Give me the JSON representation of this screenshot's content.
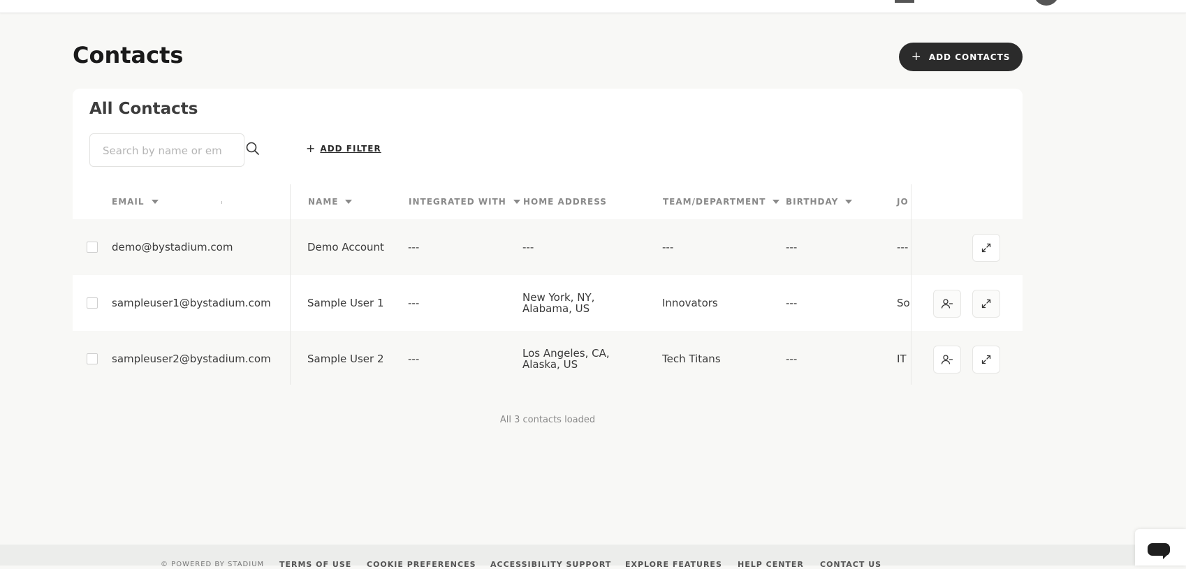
{
  "page": {
    "title": "Contacts",
    "add_contacts_label": "ADD CONTACTS"
  },
  "card": {
    "title": "All Contacts",
    "search": {
      "placeholder": "Search by name or email",
      "value": ""
    },
    "add_filter_label": "ADD FILTER"
  },
  "table": {
    "headers": {
      "email": "EMAIL",
      "name": "NAME",
      "integrated_with": "INTEGRATED WITH",
      "home_address": "HOME ADDRESS",
      "team": "TEAM/DEPARTMENT",
      "birthday": "BIRTHDAY",
      "job": "JO"
    },
    "rows": [
      {
        "email": "demo@bystadium.com",
        "name": "Demo Account",
        "integrated": "---",
        "address": "---",
        "team": "---",
        "birthday": "---",
        "job": "---"
      },
      {
        "email": "sampleuser1@bystadium.com",
        "name": "Sample User 1",
        "integrated": "---",
        "address": "New York, NY,\nAlabama, US",
        "team": "Innovators",
        "birthday": "---",
        "job": "So"
      },
      {
        "email": "sampleuser2@bystadium.com",
        "name": "Sample User 2",
        "integrated": "---",
        "address": "Los Angeles, CA,\nAlaska, US",
        "team": "Tech Titans",
        "birthday": "---",
        "job": "IT"
      }
    ]
  },
  "status": {
    "loaded_text": "All 3 contacts loaded"
  },
  "footer": {
    "powered": "© POWERED BY STADIUM",
    "links": [
      "TERMS OF USE",
      "COOKIE PREFERENCES",
      "ACCESSIBILITY SUPPORT",
      "EXPLORE FEATURES",
      "HELP CENTER",
      "CONTACT US"
    ]
  },
  "colors": {
    "primary_button": "#2b2b2b",
    "background": "#f8f8f6",
    "card": "#ffffff"
  },
  "icons": {
    "search": "search-icon",
    "remove_user": "remove-user-icon",
    "expand": "expand-icon",
    "chat": "chat-icon"
  }
}
